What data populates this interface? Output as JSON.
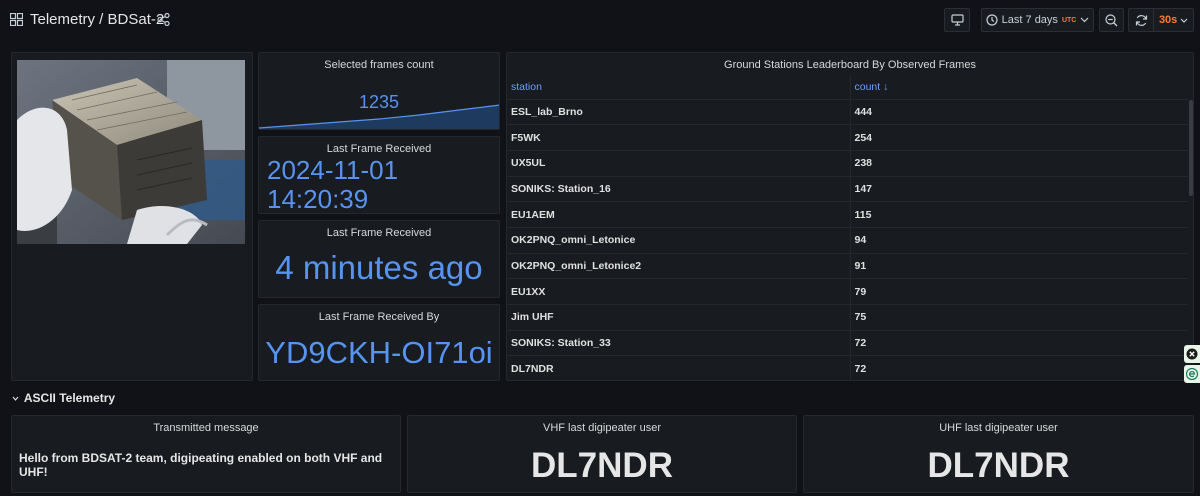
{
  "header": {
    "title": "Telemetry / BDSat-2",
    "time_range": "Last 7 days",
    "timezone": "UTC",
    "refresh_interval": "30s"
  },
  "icons": {
    "dashboard": "grid-icon",
    "share": "share-icon",
    "tv_mode": "monitor-icon",
    "time": "clock-icon",
    "zoom_out": "zoom-out-icon",
    "refresh": "refresh-icon"
  },
  "colors": {
    "stat_blue": "#5794f2",
    "accent_orange": "#ff7a2e",
    "background": "#111217",
    "panel": "#181b1f"
  },
  "panels": {
    "frames_count": {
      "title": "Selected frames count",
      "value": "1235"
    },
    "last_frame_time": {
      "title": "Last Frame Received",
      "line1": "2024-11-01",
      "line2": "14:20:39"
    },
    "last_frame_relative": {
      "title": "Last Frame Received",
      "value": "4 minutes ago"
    },
    "last_frame_by": {
      "title": "Last Frame Received By",
      "value": "YD9CKH-OI71oi"
    },
    "leaderboard": {
      "title": "Ground Stations Leaderboard By Observed Frames",
      "columns": [
        "station",
        "count"
      ],
      "sort_indicator": "↓",
      "rows": [
        {
          "station": "ESL_lab_Brno",
          "count": "444"
        },
        {
          "station": "F5WK",
          "count": "254"
        },
        {
          "station": "UX5UL",
          "count": "238"
        },
        {
          "station": "SONIKS: Station_16",
          "count": "147"
        },
        {
          "station": "EU1AEM",
          "count": "115"
        },
        {
          "station": "OK2PNQ_omni_Letonice",
          "count": "94"
        },
        {
          "station": "OK2PNQ_omni_Letonice2",
          "count": "91"
        },
        {
          "station": "EU1XX",
          "count": "79"
        },
        {
          "station": "Jim UHF",
          "count": "75"
        },
        {
          "station": "SONIKS: Station_33",
          "count": "72"
        },
        {
          "station": "DL7NDR",
          "count": "72"
        }
      ]
    }
  },
  "ascii_section": {
    "label": "ASCII Telemetry",
    "transmitted": {
      "title": "Transmitted message",
      "text": "Hello from BDSAT-2 team, digipeating enabled on both VHF and UHF!"
    },
    "vhf": {
      "title": "VHF last digipeater user",
      "value": "DL7NDR"
    },
    "uhf": {
      "title": "UHF last digipeater user",
      "value": "DL7NDR"
    }
  }
}
